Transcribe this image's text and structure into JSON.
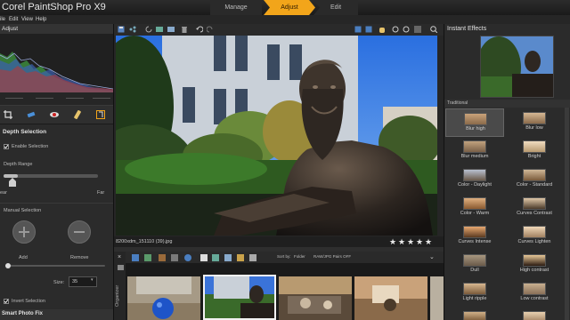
{
  "app": {
    "title": "Corel PaintShop Pro X9",
    "mode_tabs": [
      "Manage",
      "Adjust",
      "Edit"
    ],
    "menu": [
      "ile",
      "Edit",
      "View",
      "Help"
    ]
  },
  "left_panel": {
    "header": "Adjust",
    "depth_selection": {
      "title": "Depth Selection",
      "enable_selection": "Enable Selection",
      "depth_range": "Depth Range",
      "range_min": "ear",
      "range_max": "Far",
      "manual_selection": "Manual Selection",
      "add_label": "Add",
      "remove_label": "Remove",
      "size_label": "Size:",
      "size_value": "35",
      "invert_selection": "Invert Selection"
    },
    "next_section": "Smart Photo Fix"
  },
  "center": {
    "filename": "8200xdm_151110 (39).jpg",
    "rating_stars": 5,
    "organizer_label": "Organizer",
    "sort_by_label": "Sort by:",
    "sort_by_value": "Folder",
    "raw_option": "RAW/JPG Pairs OFF"
  },
  "right_panel": {
    "title": "Instant Effects",
    "category": "Traditional",
    "effects": [
      "Blur high",
      "Blur low",
      "Blur medium",
      "Bright",
      "Color - Daylight",
      "Color - Standard",
      "Color - Warm",
      "Curves Contrast",
      "Curves Intense",
      "Curves Lighten",
      "Dull",
      "High contrast",
      "Light ripple",
      "Low contrast",
      "Lukis...",
      "Soft light"
    ],
    "selected_effect": "Blur high"
  },
  "colors": {
    "accent": "#f2a51a",
    "panel_bg": "#2b2b2b",
    "title_bg": "#1e1e1e"
  }
}
